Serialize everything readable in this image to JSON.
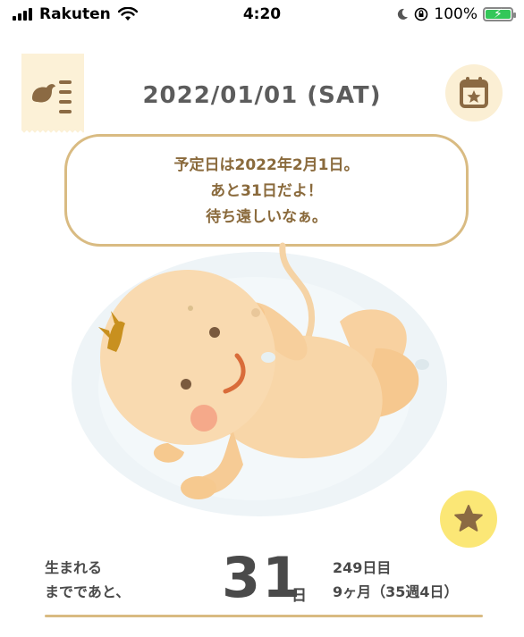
{
  "status_bar": {
    "carrier": "Rakuten",
    "time": "4:20",
    "battery": "100%"
  },
  "header": {
    "date": "2022/01/01 (SAT)",
    "menu_icon": "bird-menu-icon",
    "calendar_icon": "calendar-star-icon"
  },
  "bubble": {
    "lines": [
      "予定日は2022年2月1日。",
      "あと31日だよ！",
      "待ち遠しいなぁ。"
    ]
  },
  "illustration": {
    "subject": "baby-icon"
  },
  "favorite": {
    "icon": "star-icon"
  },
  "counter": {
    "label_line1": "生まれる",
    "label_line2": "までであと、",
    "days": "31",
    "days_unit": "日",
    "elapsed_days": "249日目",
    "month_week": "9ヶ月（35週4日）"
  },
  "colors": {
    "accent": "#d9bb82",
    "text_brown": "#8a6a3c",
    "tag_bg": "#fcf1d7",
    "star_bg": "#fbe776"
  }
}
